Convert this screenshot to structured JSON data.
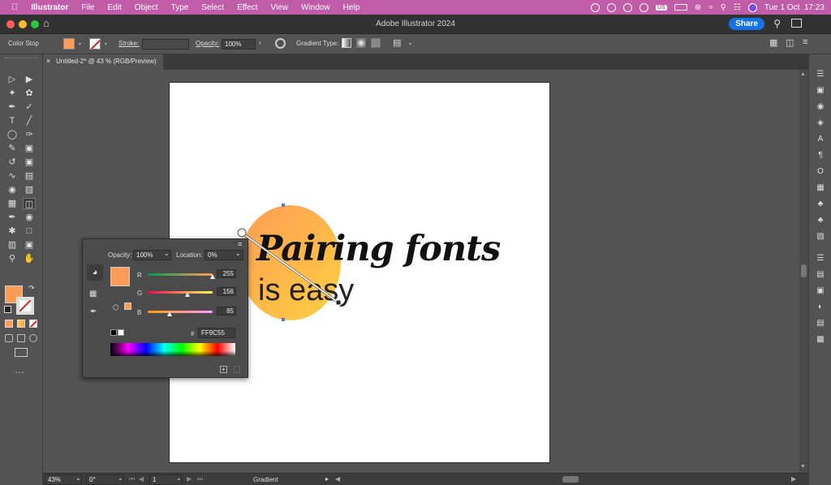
{
  "menubar": {
    "app_name": "Illustrator",
    "menus": [
      "File",
      "Edit",
      "Object",
      "Type",
      "Select",
      "Effect",
      "View",
      "Window",
      "Help"
    ],
    "status_items": {
      "language": "US",
      "datetime": "Tue 1 Oct  17:23"
    }
  },
  "window": {
    "title": "Adobe Illustrator 2024",
    "share_label": "Share"
  },
  "control_bar": {
    "context_label": "Color Stop",
    "fill_color": "#ff9c55",
    "stroke_label": "Stroke:",
    "opacity_label": "Opacity:",
    "opacity_value": "100%",
    "gradient_type_label": "Gradient Type:"
  },
  "document_tab": {
    "label": "Untitled-2* @ 43 % (RGB/Preview)",
    "close": "×"
  },
  "artboard": {
    "text_line1": "Pairing fonts",
    "text_line2": "is easy",
    "gradient_start": "#ff9c55",
    "gradient_end": "#ffd040"
  },
  "color_panel": {
    "opacity_label": "Opacity:",
    "opacity_value": "100%",
    "location_label": "Location:",
    "location_value": "0%",
    "r_label": "R",
    "r_value": "255",
    "g_label": "G",
    "g_value": "156",
    "b_label": "B",
    "b_value": "85",
    "hash_label": "#",
    "hex_value": "FF9C55",
    "r_level": 1.0,
    "g_level": 0.612,
    "b_level": 0.333
  },
  "status_bar": {
    "zoom": "43%",
    "rotation": "0°",
    "artboard_number": "1",
    "tool_name": "Gradient"
  },
  "tools_left": [
    "selection-tool",
    "direct-selection-tool",
    "magic-wand-tool",
    "lasso-tool",
    "pen-tool",
    "curvature-tool",
    "type-tool",
    "line-tool",
    "ellipse-tool",
    "paintbrush-tool",
    "shaper-tool",
    "eraser-tool",
    "rotate-tool",
    "scale-tool",
    "width-tool",
    "free-transform-tool",
    "shape-builder-tool",
    "perspective-tool",
    "mesh-tool",
    "gradient-tool",
    "eyedropper-tool",
    "blend-tool",
    "symbol-sprayer-tool",
    "artboard-tool",
    "column-graph-tool",
    "slice-tool",
    "zoom-tool",
    "hand-tool"
  ],
  "dock_right": [
    "properties",
    "libraries",
    "color",
    "color-guide",
    "character",
    "paragraph",
    "opentype",
    "transform",
    "symbols",
    "brushes",
    "gradient",
    "layers",
    "align",
    "pathfinder",
    "transparency",
    "appearance",
    "graphic-styles"
  ]
}
